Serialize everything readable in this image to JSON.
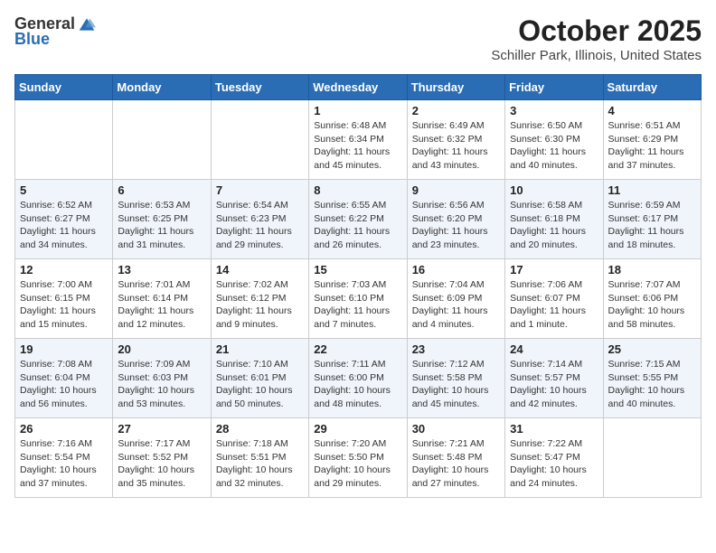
{
  "logo": {
    "general": "General",
    "blue": "Blue"
  },
  "header": {
    "month": "October 2025",
    "location": "Schiller Park, Illinois, United States"
  },
  "weekdays": [
    "Sunday",
    "Monday",
    "Tuesday",
    "Wednesday",
    "Thursday",
    "Friday",
    "Saturday"
  ],
  "weeks": [
    [
      {
        "day": "",
        "sunrise": "",
        "sunset": "",
        "daylight": ""
      },
      {
        "day": "",
        "sunrise": "",
        "sunset": "",
        "daylight": ""
      },
      {
        "day": "",
        "sunrise": "",
        "sunset": "",
        "daylight": ""
      },
      {
        "day": "1",
        "sunrise": "Sunrise: 6:48 AM",
        "sunset": "Sunset: 6:34 PM",
        "daylight": "Daylight: 11 hours and 45 minutes."
      },
      {
        "day": "2",
        "sunrise": "Sunrise: 6:49 AM",
        "sunset": "Sunset: 6:32 PM",
        "daylight": "Daylight: 11 hours and 43 minutes."
      },
      {
        "day": "3",
        "sunrise": "Sunrise: 6:50 AM",
        "sunset": "Sunset: 6:30 PM",
        "daylight": "Daylight: 11 hours and 40 minutes."
      },
      {
        "day": "4",
        "sunrise": "Sunrise: 6:51 AM",
        "sunset": "Sunset: 6:29 PM",
        "daylight": "Daylight: 11 hours and 37 minutes."
      }
    ],
    [
      {
        "day": "5",
        "sunrise": "Sunrise: 6:52 AM",
        "sunset": "Sunset: 6:27 PM",
        "daylight": "Daylight: 11 hours and 34 minutes."
      },
      {
        "day": "6",
        "sunrise": "Sunrise: 6:53 AM",
        "sunset": "Sunset: 6:25 PM",
        "daylight": "Daylight: 11 hours and 31 minutes."
      },
      {
        "day": "7",
        "sunrise": "Sunrise: 6:54 AM",
        "sunset": "Sunset: 6:23 PM",
        "daylight": "Daylight: 11 hours and 29 minutes."
      },
      {
        "day": "8",
        "sunrise": "Sunrise: 6:55 AM",
        "sunset": "Sunset: 6:22 PM",
        "daylight": "Daylight: 11 hours and 26 minutes."
      },
      {
        "day": "9",
        "sunrise": "Sunrise: 6:56 AM",
        "sunset": "Sunset: 6:20 PM",
        "daylight": "Daylight: 11 hours and 23 minutes."
      },
      {
        "day": "10",
        "sunrise": "Sunrise: 6:58 AM",
        "sunset": "Sunset: 6:18 PM",
        "daylight": "Daylight: 11 hours and 20 minutes."
      },
      {
        "day": "11",
        "sunrise": "Sunrise: 6:59 AM",
        "sunset": "Sunset: 6:17 PM",
        "daylight": "Daylight: 11 hours and 18 minutes."
      }
    ],
    [
      {
        "day": "12",
        "sunrise": "Sunrise: 7:00 AM",
        "sunset": "Sunset: 6:15 PM",
        "daylight": "Daylight: 11 hours and 15 minutes."
      },
      {
        "day": "13",
        "sunrise": "Sunrise: 7:01 AM",
        "sunset": "Sunset: 6:14 PM",
        "daylight": "Daylight: 11 hours and 12 minutes."
      },
      {
        "day": "14",
        "sunrise": "Sunrise: 7:02 AM",
        "sunset": "Sunset: 6:12 PM",
        "daylight": "Daylight: 11 hours and 9 minutes."
      },
      {
        "day": "15",
        "sunrise": "Sunrise: 7:03 AM",
        "sunset": "Sunset: 6:10 PM",
        "daylight": "Daylight: 11 hours and 7 minutes."
      },
      {
        "day": "16",
        "sunrise": "Sunrise: 7:04 AM",
        "sunset": "Sunset: 6:09 PM",
        "daylight": "Daylight: 11 hours and 4 minutes."
      },
      {
        "day": "17",
        "sunrise": "Sunrise: 7:06 AM",
        "sunset": "Sunset: 6:07 PM",
        "daylight": "Daylight: 11 hours and 1 minute."
      },
      {
        "day": "18",
        "sunrise": "Sunrise: 7:07 AM",
        "sunset": "Sunset: 6:06 PM",
        "daylight": "Daylight: 10 hours and 58 minutes."
      }
    ],
    [
      {
        "day": "19",
        "sunrise": "Sunrise: 7:08 AM",
        "sunset": "Sunset: 6:04 PM",
        "daylight": "Daylight: 10 hours and 56 minutes."
      },
      {
        "day": "20",
        "sunrise": "Sunrise: 7:09 AM",
        "sunset": "Sunset: 6:03 PM",
        "daylight": "Daylight: 10 hours and 53 minutes."
      },
      {
        "day": "21",
        "sunrise": "Sunrise: 7:10 AM",
        "sunset": "Sunset: 6:01 PM",
        "daylight": "Daylight: 10 hours and 50 minutes."
      },
      {
        "day": "22",
        "sunrise": "Sunrise: 7:11 AM",
        "sunset": "Sunset: 6:00 PM",
        "daylight": "Daylight: 10 hours and 48 minutes."
      },
      {
        "day": "23",
        "sunrise": "Sunrise: 7:12 AM",
        "sunset": "Sunset: 5:58 PM",
        "daylight": "Daylight: 10 hours and 45 minutes."
      },
      {
        "day": "24",
        "sunrise": "Sunrise: 7:14 AM",
        "sunset": "Sunset: 5:57 PM",
        "daylight": "Daylight: 10 hours and 42 minutes."
      },
      {
        "day": "25",
        "sunrise": "Sunrise: 7:15 AM",
        "sunset": "Sunset: 5:55 PM",
        "daylight": "Daylight: 10 hours and 40 minutes."
      }
    ],
    [
      {
        "day": "26",
        "sunrise": "Sunrise: 7:16 AM",
        "sunset": "Sunset: 5:54 PM",
        "daylight": "Daylight: 10 hours and 37 minutes."
      },
      {
        "day": "27",
        "sunrise": "Sunrise: 7:17 AM",
        "sunset": "Sunset: 5:52 PM",
        "daylight": "Daylight: 10 hours and 35 minutes."
      },
      {
        "day": "28",
        "sunrise": "Sunrise: 7:18 AM",
        "sunset": "Sunset: 5:51 PM",
        "daylight": "Daylight: 10 hours and 32 minutes."
      },
      {
        "day": "29",
        "sunrise": "Sunrise: 7:20 AM",
        "sunset": "Sunset: 5:50 PM",
        "daylight": "Daylight: 10 hours and 29 minutes."
      },
      {
        "day": "30",
        "sunrise": "Sunrise: 7:21 AM",
        "sunset": "Sunset: 5:48 PM",
        "daylight": "Daylight: 10 hours and 27 minutes."
      },
      {
        "day": "31",
        "sunrise": "Sunrise: 7:22 AM",
        "sunset": "Sunset: 5:47 PM",
        "daylight": "Daylight: 10 hours and 24 minutes."
      },
      {
        "day": "",
        "sunrise": "",
        "sunset": "",
        "daylight": ""
      }
    ]
  ]
}
